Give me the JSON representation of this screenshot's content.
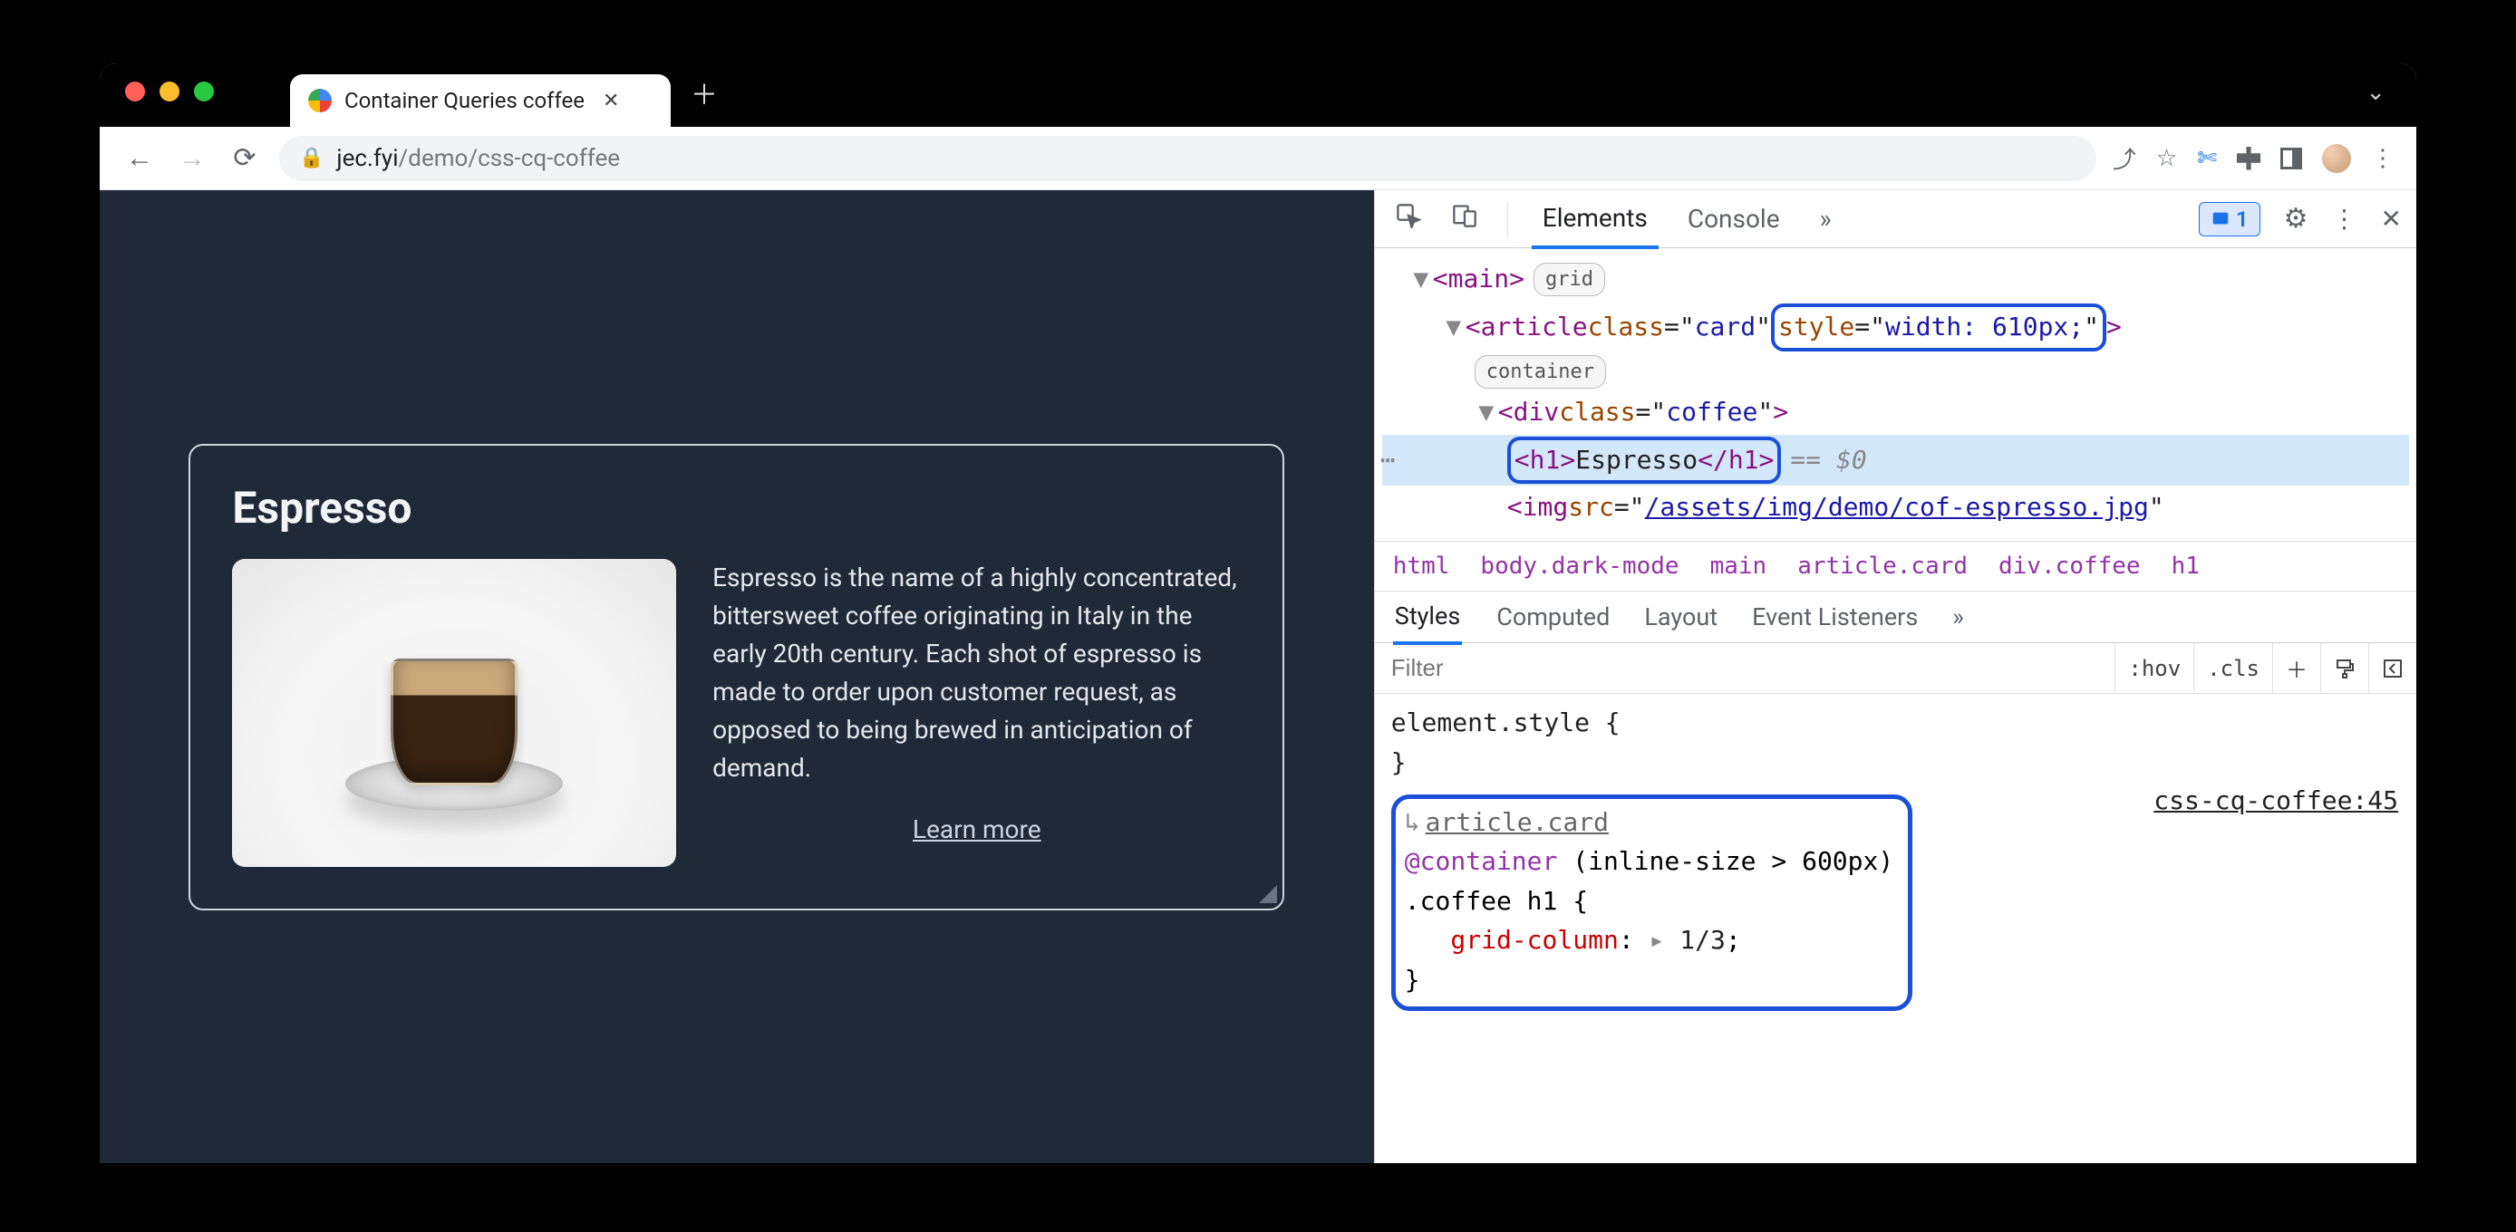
{
  "browser": {
    "tab_title": "Container Queries coffee",
    "omnibox_domain": "jec.fyi",
    "omnibox_path": "/demo/css-cq-coffee"
  },
  "page": {
    "heading": "Espresso",
    "description": "Espresso is the name of a highly concentrated, bittersweet coffee originating in Italy in the early 20th century. Each shot of espresso is made to order upon customer request, as opposed to being brewed in anticipation of demand.",
    "learn_more": "Learn more"
  },
  "devtools": {
    "tabs": {
      "elements": "Elements",
      "console": "Console"
    },
    "issues_count": "1",
    "dom": {
      "main_badge": "grid",
      "article_badge": "container",
      "article_class": "card",
      "article_style": "width: 610px;",
      "div_class": "coffee",
      "h1_text": "Espresso",
      "img_src": "/assets/img/demo/cof-espresso.jpg",
      "sel_marker": "== $0"
    },
    "crumbs": [
      "html",
      "body.dark-mode",
      "main",
      "article.card",
      "div.coffee",
      "h1"
    ],
    "styles_tabs": {
      "styles": "Styles",
      "computed": "Computed",
      "layout": "Layout",
      "listeners": "Event Listeners"
    },
    "filter_placeholder": "Filter",
    "hov": ":hov",
    "cls": ".cls",
    "element_style": "element.style {",
    "rule": {
      "origin_selector": "article.card",
      "container": "@container (inline-size > 600px)",
      "selector": ".coffee h1 {",
      "prop": "grid-column",
      "val": "1/3",
      "close": "}",
      "source": "css-cq-coffee:45"
    }
  }
}
